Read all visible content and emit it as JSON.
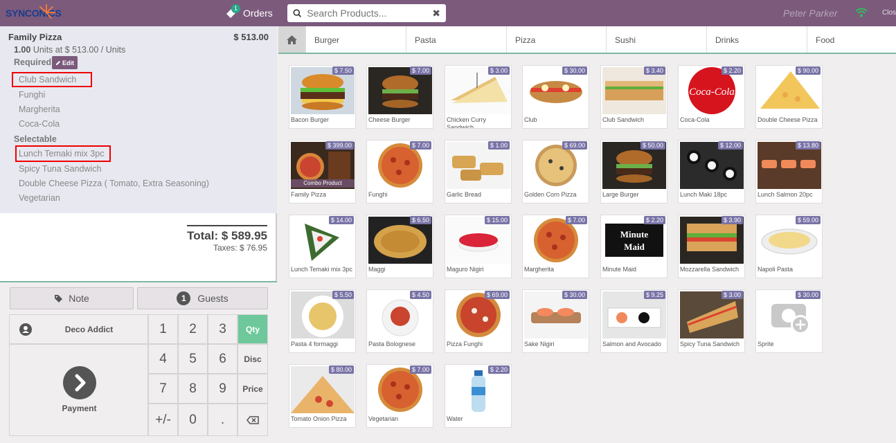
{
  "topbar": {
    "logo": "SYNCONICS",
    "orders_label": "Orders",
    "orders_count": "1",
    "search_placeholder": "Search Products...",
    "user": "Peter Parker",
    "close_label": "Close"
  },
  "order": {
    "product": "Family Pizza",
    "price": "$ 513.00",
    "qty": "1.00",
    "qty_detail": "Units at $ 513.00 / Units",
    "required_label": "Required",
    "edit_label": "Edit",
    "required_items": [
      "Club Sandwich",
      "Funghi",
      "Margherita",
      "Coca-Cola"
    ],
    "selectable_label": "Selectable",
    "selectable_items": [
      "Lunch Temaki mix 3pc",
      "Spicy Tuna Sandwich",
      "Double Cheese Pizza ( Tomato, Extra Seasoning)",
      "Vegetarian"
    ],
    "total": "Total: $ 589.95",
    "taxes": "Taxes: $ 76.95"
  },
  "controls": {
    "note": "Note",
    "guests_count": "1",
    "guests": "Guests",
    "customer": "Deco Addict",
    "payment": "Payment",
    "keys": [
      "1",
      "2",
      "3",
      "4",
      "5",
      "6",
      "7",
      "8",
      "9",
      "+/-",
      "0",
      "."
    ],
    "modes": [
      "Qty",
      "Disc",
      "Price"
    ],
    "active_mode": "Qty"
  },
  "categories": [
    "Burger",
    "Pasta",
    "Pizza",
    "Sushi",
    "Drinks",
    "Food"
  ],
  "products": [
    {
      "name": "Bacon Burger",
      "price": "$ 7.50",
      "img": "burger"
    },
    {
      "name": "Cheese Burger",
      "price": "$ 7.00",
      "img": "burger-dark"
    },
    {
      "name": "Chicken Curry Sandwich",
      "price": "$ 3.00",
      "img": "sandwich"
    },
    {
      "name": "Club",
      "price": "$ 30.00",
      "img": "sub"
    },
    {
      "name": "Club Sandwich",
      "price": "$ 3.40",
      "img": "sandwich2"
    },
    {
      "name": "Coca-Cola",
      "price": "$ 2.20",
      "img": "coke"
    },
    {
      "name": "Double Cheese Pizza",
      "price": "$ 90.00",
      "img": "pizza-slice"
    },
    {
      "name": "Family Pizza",
      "price": "$ 399.00",
      "img": "combo"
    },
    {
      "name": "Funghi",
      "price": "$ 7.00",
      "img": "pizza"
    },
    {
      "name": "Garlic Bread",
      "price": "$ 1.00",
      "img": "bread"
    },
    {
      "name": "Golden Corn Pizza",
      "price": "$ 69.00",
      "img": "pizza2"
    },
    {
      "name": "Large Burger",
      "price": "$ 50.00",
      "img": "burger-dark"
    },
    {
      "name": "Lunch Maki 18pc",
      "price": "$ 12.00",
      "img": "sushi"
    },
    {
      "name": "Lunch Salmon 20pc",
      "price": "$ 13.80",
      "img": "sushi2"
    },
    {
      "name": "Lunch Temaki mix 3pc",
      "price": "$ 14.00",
      "img": "temaki"
    },
    {
      "name": "Maggi",
      "price": "$ 6.50",
      "img": "noodles"
    },
    {
      "name": "Maguro Nigiri",
      "price": "$ 15.00",
      "img": "nigiri"
    },
    {
      "name": "Margherita",
      "price": "$ 7.00",
      "img": "pizza"
    },
    {
      "name": "Minute Maid",
      "price": "$ 2.20",
      "img": "minutemaid"
    },
    {
      "name": "Mozzarella Sandwich",
      "price": "$ 3.90",
      "img": "sandwich3"
    },
    {
      "name": "Napoli Pasta",
      "price": "$ 59.00",
      "img": "pasta"
    },
    {
      "name": "Pasta 4 formaggi",
      "price": "$ 5.50",
      "img": "pasta2"
    },
    {
      "name": "Pasta Bolognese",
      "price": "$ 4.50",
      "img": "bolognese"
    },
    {
      "name": "Pizza Funghi",
      "price": "$ 69.00",
      "img": "pizza3"
    },
    {
      "name": "Sake Nigiri",
      "price": "$ 30.00",
      "img": "sake"
    },
    {
      "name": "Salmon and Avocado",
      "price": "$ 9.25",
      "img": "salmon"
    },
    {
      "name": "Spicy Tuna Sandwich",
      "price": "$ 3.00",
      "img": "panini"
    },
    {
      "name": "Sprite",
      "price": "$ 30.00",
      "img": "placeholder"
    },
    {
      "name": "Tomato Onion Pizza",
      "price": "$ 80.00",
      "img": "pizza4"
    },
    {
      "name": "Vegetarian",
      "price": "$ 7.00",
      "img": "pizza"
    },
    {
      "name": "Water",
      "price": "$ 2.20",
      "img": "water"
    }
  ]
}
